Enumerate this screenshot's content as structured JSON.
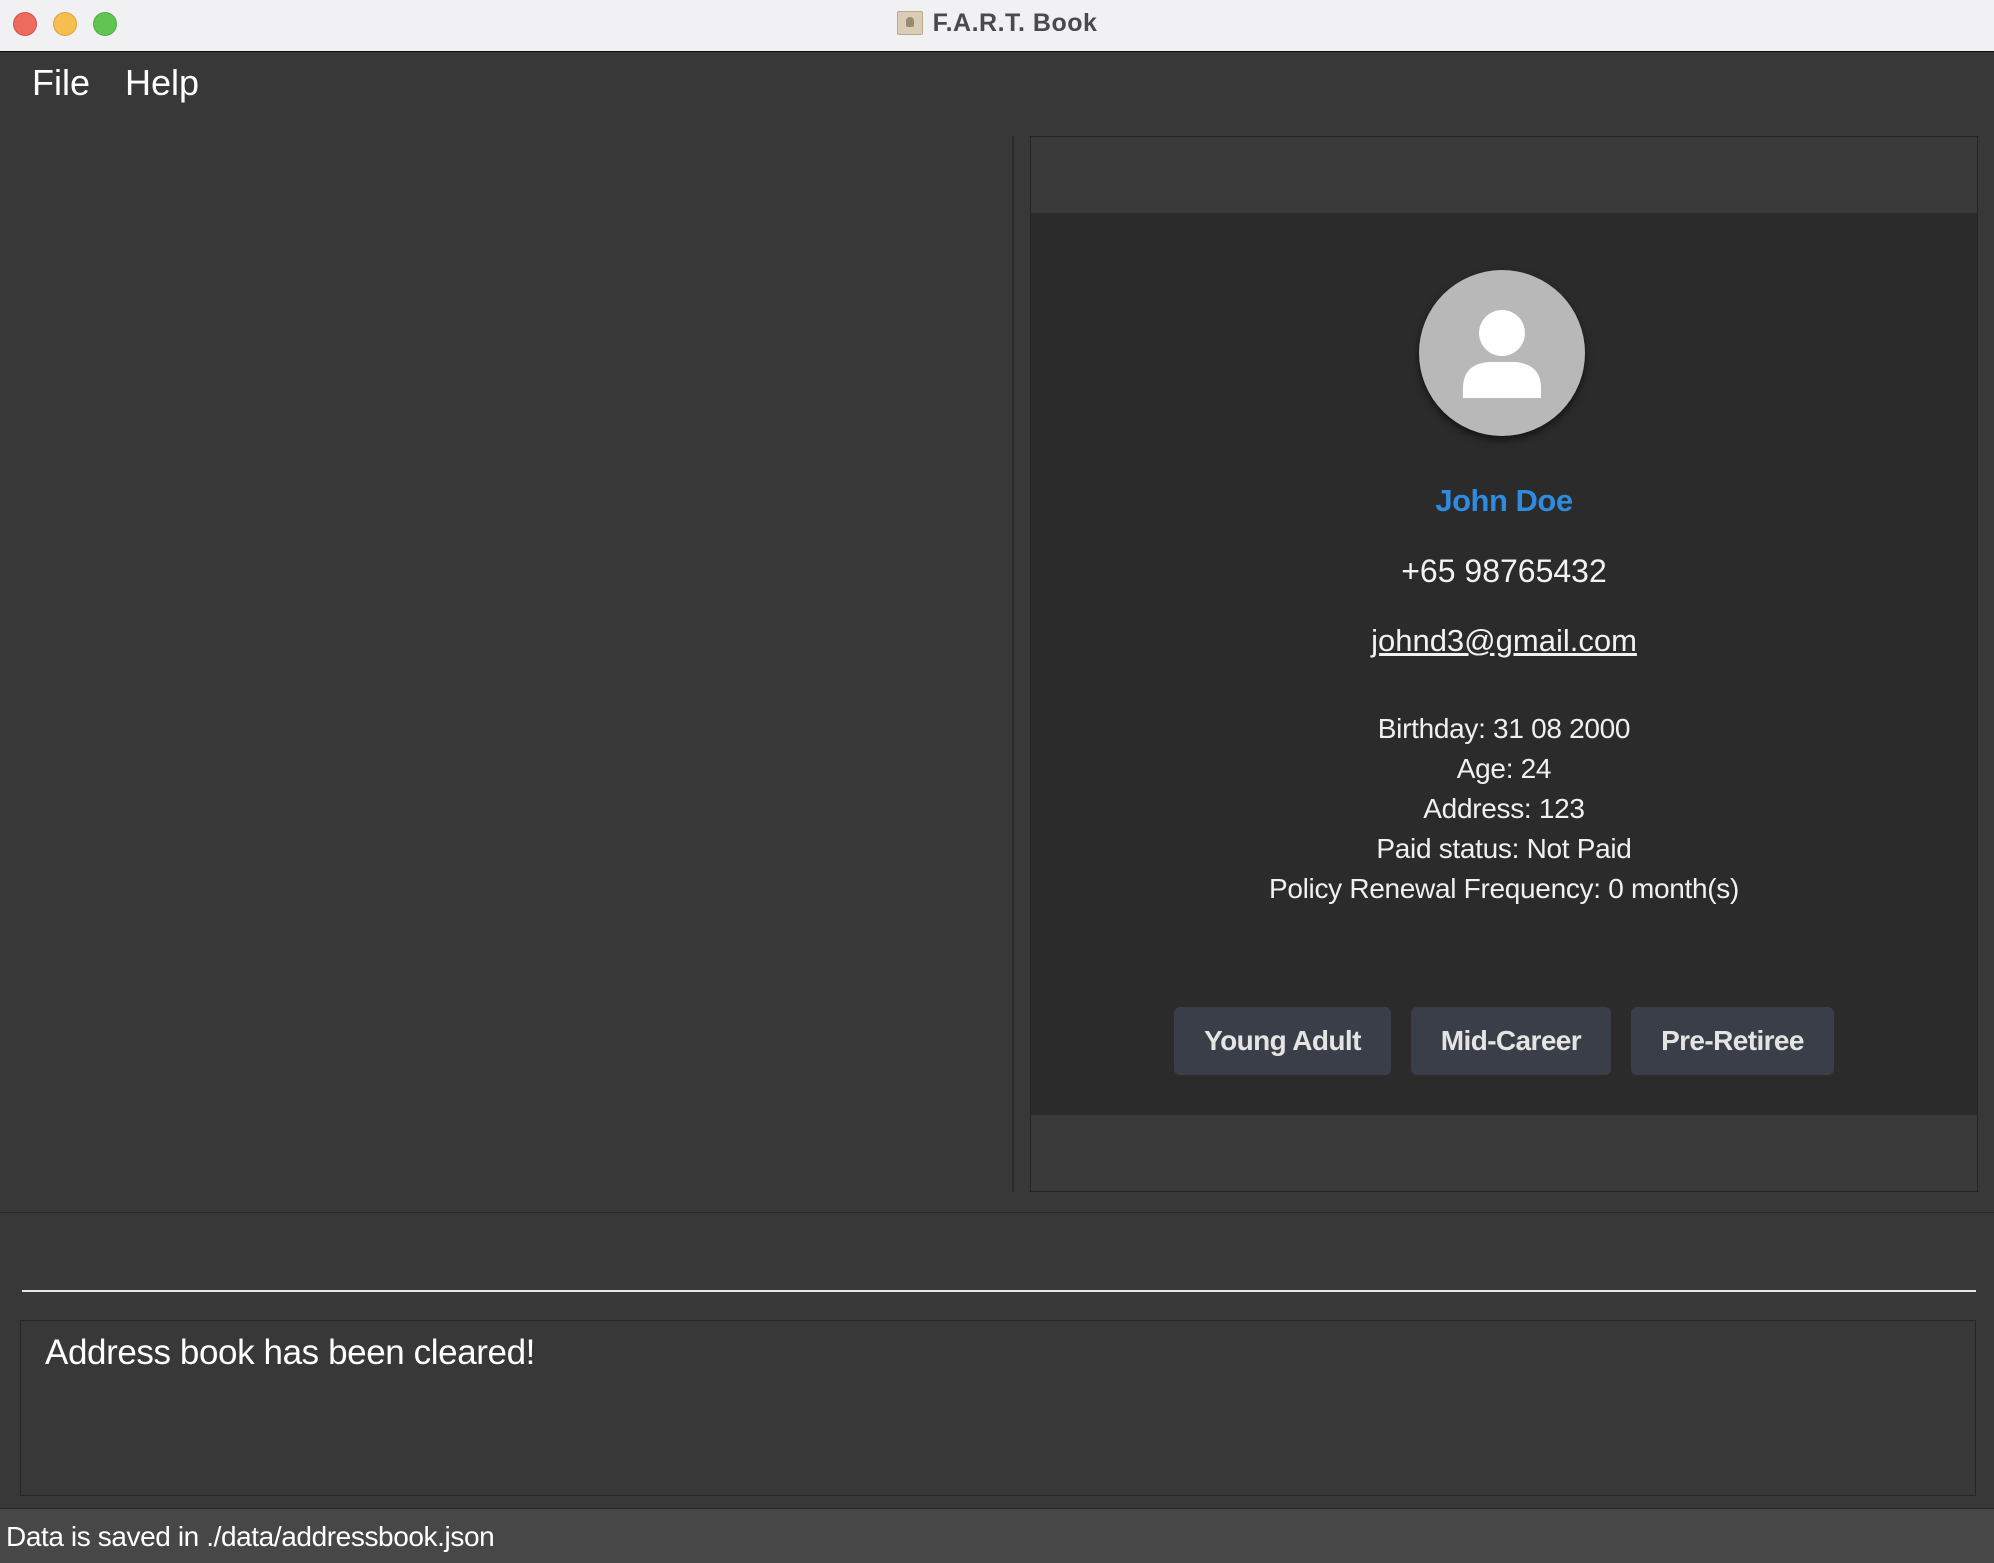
{
  "window": {
    "title": "F.A.R.T. Book",
    "app_icon": "address-book-icon"
  },
  "menu": {
    "items": [
      {
        "label": "File"
      },
      {
        "label": "Help"
      }
    ]
  },
  "person_detail": {
    "avatar_icon": "person-icon",
    "name": "John Doe",
    "phone": "+65 98765432",
    "email": "johnd3@gmail.com",
    "birthday": "Birthday: 31 08 2000",
    "age": "Age: 24",
    "address": "Address: 123",
    "paid_status": "Paid status: Not Paid",
    "renewal_frequency": "Policy Renewal Frequency: 0 month(s)",
    "tags": [
      {
        "label": "Young Adult"
      },
      {
        "label": "Mid-Career"
      },
      {
        "label": "Pre-Retiree"
      }
    ]
  },
  "command_box": {
    "value": "",
    "placeholder": ""
  },
  "result_display": {
    "message": "Address book has been cleared!"
  },
  "status_bar": {
    "text": "Data is saved in ./data/addressbook.json"
  },
  "colors": {
    "accent_name": "#2f8bdf",
    "background": "#383838",
    "card_background": "#2b2b2b",
    "tag_background": "#3a3e48"
  }
}
